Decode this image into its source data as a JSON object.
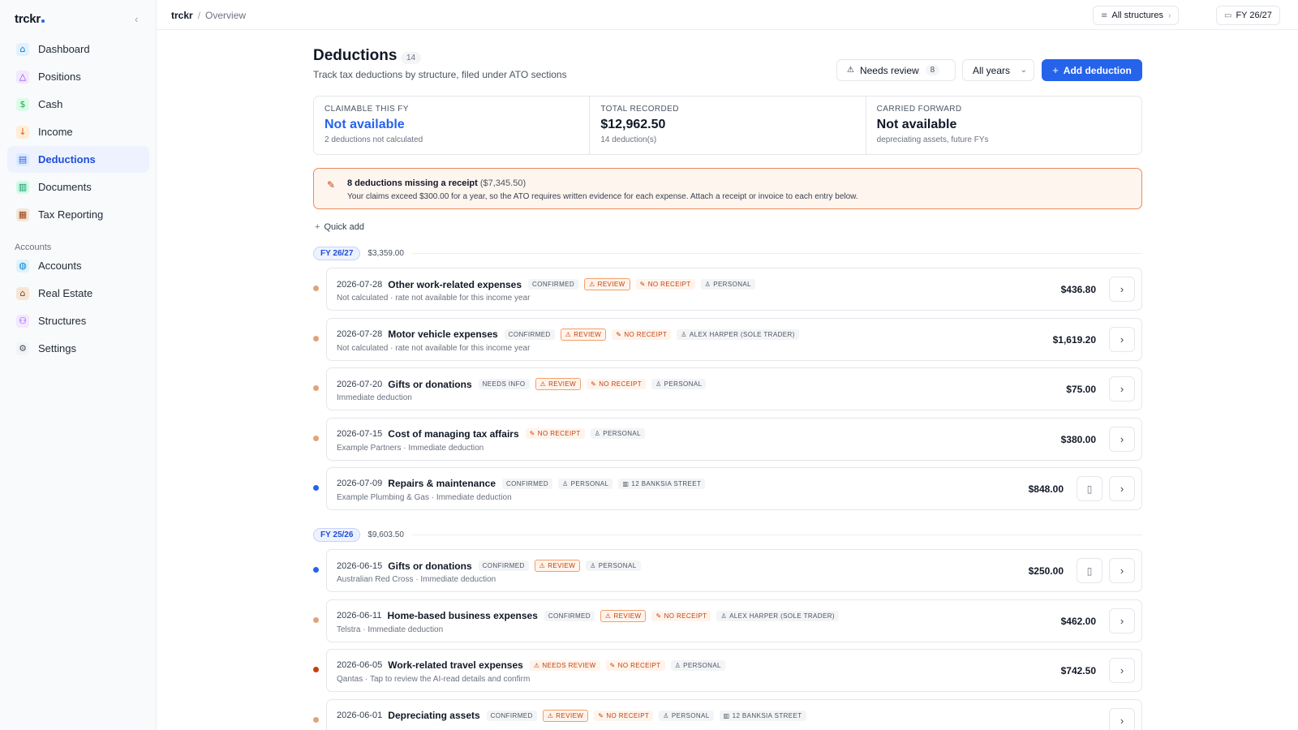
{
  "app": {
    "logo": "trckr"
  },
  "sidebar": {
    "items": [
      {
        "label": "Dashboard",
        "icon": "dashboard-icon",
        "color": "#e0f2fe",
        "glyph": "⌂",
        "glyph_color": "#0284c7"
      },
      {
        "label": "Positions",
        "icon": "positions-icon",
        "color": "#f3e8ff",
        "glyph": "△",
        "glyph_color": "#7c3aed"
      },
      {
        "label": "Cash",
        "icon": "cash-icon",
        "color": "#dcfce7",
        "glyph": "$",
        "glyph_color": "#16a34a"
      },
      {
        "label": "Income",
        "icon": "income-icon",
        "color": "#ffedd5",
        "glyph": "↓",
        "glyph_color": "#ea580c"
      },
      {
        "label": "Deductions",
        "icon": "deductions-icon",
        "color": "#dbeafe",
        "glyph": "▤",
        "glyph_color": "#2563eb",
        "active": true
      },
      {
        "label": "Documents",
        "icon": "documents-icon",
        "color": "#d1fae5",
        "glyph": "▥",
        "glyph_color": "#059669"
      },
      {
        "label": "Tax Reporting",
        "icon": "tax-reporting-icon",
        "color": "#f5e6d8",
        "glyph": "▦",
        "glyph_color": "#92400e"
      }
    ],
    "section_label": "Accounts",
    "account_items": [
      {
        "label": "Accounts",
        "icon": "accounts-icon",
        "color": "#e0f2fe",
        "glyph": "◍",
        "glyph_color": "#0284c7"
      },
      {
        "label": "Real Estate",
        "icon": "real-estate-icon",
        "color": "#f5e6d8",
        "glyph": "⌂",
        "glyph_color": "#92400e"
      },
      {
        "label": "Structures",
        "icon": "structures-icon",
        "color": "#f3e8ff",
        "glyph": "⚇",
        "glyph_color": "#7c3aed"
      },
      {
        "label": "Settings",
        "icon": "settings-icon",
        "color": "#f3f4f6",
        "glyph": "⚙",
        "glyph_color": "#4b5563"
      }
    ]
  },
  "topbar": {
    "breadcrumb_root": "trckr",
    "breadcrumb_sep": "/",
    "breadcrumb_page": "Overview",
    "structures_label": "All structures",
    "fy_label": "FY 26/27"
  },
  "page": {
    "title": "Deductions",
    "count": "14",
    "subtitle": "Track tax deductions by structure, filed under ATO sections",
    "review_label": "Needs review",
    "review_count": "8",
    "years_label": "All years",
    "add_label": "Add deduction",
    "accent_color": "#2563eb"
  },
  "stats": [
    {
      "label": "CLAIMABLE THIS FY",
      "value": "Not available",
      "sub": "2 deductions not calculated",
      "blue": true
    },
    {
      "label": "TOTAL RECORDED",
      "value": "$12,962.50",
      "sub": "14 deduction(s)",
      "blue": false
    },
    {
      "label": "CARRIED FORWARD",
      "value": "Not available",
      "sub": "depreciating assets, future FYs",
      "blue": false
    }
  ],
  "alert": {
    "title": "8 deductions missing a receipt",
    "amount": "($7,345.50)",
    "text": "Your claims exceed $300.00 for a year, so the ATO requires written evidence for each expense. Attach a receipt or invoice to each entry below."
  },
  "quick_add": "Quick add",
  "groups": [
    {
      "fy": "FY 26/27",
      "total": "$3,359.00",
      "rows": [
        {
          "date": "2026-07-28",
          "title": "Other work-related expenses",
          "tags": [
            [
              "CONFIRMED",
              "plain"
            ],
            [
              "REVIEW",
              "review"
            ],
            [
              "NO RECEIPT",
              "noreceipt"
            ],
            [
              "PERSONAL",
              "person"
            ]
          ],
          "sub": "Not calculated · rate not available for this income year",
          "amount": "$436.80",
          "dot": "#e0a47a",
          "doc": false
        },
        {
          "date": "2026-07-28",
          "title": "Motor vehicle expenses",
          "tags": [
            [
              "CONFIRMED",
              "plain"
            ],
            [
              "REVIEW",
              "review"
            ],
            [
              "NO RECEIPT",
              "noreceipt"
            ],
            [
              "ALEX HARPER (SOLE TRADER)",
              "person"
            ]
          ],
          "sub": "Not calculated · rate not available for this income year",
          "amount": "$1,619.20",
          "dot": "#e0a47a",
          "doc": false
        },
        {
          "date": "2026-07-20",
          "title": "Gifts or donations",
          "tags": [
            [
              "NEEDS INFO",
              "plain"
            ],
            [
              "REVIEW",
              "review"
            ],
            [
              "NO RECEIPT",
              "noreceipt"
            ],
            [
              "PERSONAL",
              "person"
            ]
          ],
          "sub": "Immediate deduction",
          "amount": "$75.00",
          "dot": "#e0a47a",
          "doc": false
        },
        {
          "date": "2026-07-15",
          "title": "Cost of managing tax affairs",
          "tags": [
            [
              "NO RECEIPT",
              "noreceipt"
            ],
            [
              "PERSONAL",
              "person"
            ]
          ],
          "sub": "Example Partners · Immediate deduction",
          "amount": "$380.00",
          "dot": "#e0a47a",
          "doc": false
        },
        {
          "date": "2026-07-09",
          "title": "Repairs & maintenance",
          "tags": [
            [
              "CONFIRMED",
              "plain"
            ],
            [
              "PERSONAL",
              "person"
            ],
            [
              "12 BANKSIA STREET",
              "property"
            ]
          ],
          "sub": "Example Plumbing & Gas · Immediate deduction",
          "amount": "$848.00",
          "dot": "#2563eb",
          "doc": true
        }
      ]
    },
    {
      "fy": "FY 25/26",
      "total": "$9,603.50",
      "rows": [
        {
          "date": "2026-06-15",
          "title": "Gifts or donations",
          "tags": [
            [
              "CONFIRMED",
              "plain"
            ],
            [
              "REVIEW",
              "review"
            ],
            [
              "PERSONAL",
              "person"
            ]
          ],
          "sub": "Australian Red Cross · Immediate deduction",
          "amount": "$250.00",
          "dot": "#2563eb",
          "doc": true
        },
        {
          "date": "2026-06-11",
          "title": "Home-based business expenses",
          "tags": [
            [
              "CONFIRMED",
              "plain"
            ],
            [
              "REVIEW",
              "review"
            ],
            [
              "NO RECEIPT",
              "noreceipt"
            ],
            [
              "ALEX HARPER (SOLE TRADER)",
              "person"
            ]
          ],
          "sub": "Telstra · Immediate deduction",
          "amount": "$462.00",
          "dot": "#e0a47a",
          "doc": false
        },
        {
          "date": "2026-06-05",
          "title": "Work-related travel expenses",
          "tags": [
            [
              "NEEDS REVIEW",
              "needsreview"
            ],
            [
              "NO RECEIPT",
              "noreceipt"
            ],
            [
              "PERSONAL",
              "person"
            ]
          ],
          "sub": "Qantas · Tap to review the AI-read details and confirm",
          "amount": "$742.50",
          "dot": "#c2410c",
          "doc": false
        },
        {
          "date": "2026-06-01",
          "title": "Depreciating assets",
          "tags": [
            [
              "CONFIRMED",
              "plain"
            ],
            [
              "REVIEW",
              "review"
            ],
            [
              "NO RECEIPT",
              "noreceipt"
            ],
            [
              "PERSONAL",
              "person"
            ],
            [
              "12 BANKSIA STREET",
              "property"
            ]
          ],
          "sub": "",
          "amount": "",
          "dot": "#e0a47a",
          "doc": false
        }
      ]
    }
  ]
}
